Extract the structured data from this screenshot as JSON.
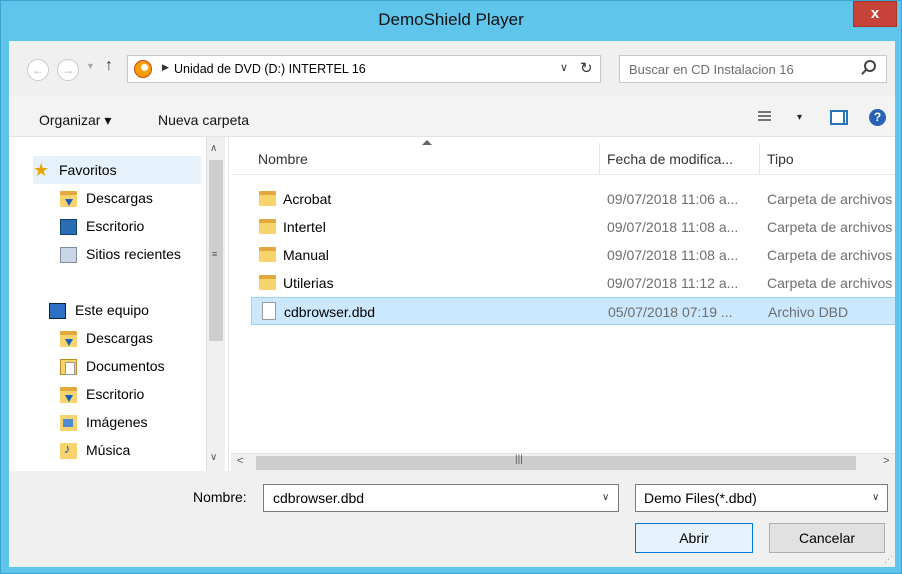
{
  "window": {
    "title": "DemoShield Player",
    "close_label": "x"
  },
  "address": {
    "back": "←",
    "forward": "→",
    "up": "↑",
    "breadcrumb": "Unidad de DVD (D:) INTERTEL 16",
    "dropdown": "∨",
    "refresh": "↻"
  },
  "search": {
    "placeholder": "Buscar en CD Instalacion 16"
  },
  "toolbar": {
    "organize": "Organizar ▾",
    "new_folder": "Nueva carpeta",
    "view_dd": "▾",
    "help": "?"
  },
  "nav": {
    "favorites": {
      "label": "Favoritos",
      "items": [
        "Descargas",
        "Escritorio",
        "Sitios recientes"
      ]
    },
    "this_pc": {
      "label": "Este equipo",
      "items": [
        "Descargas",
        "Documentos",
        "Escritorio",
        "Imágenes",
        "Música"
      ]
    }
  },
  "list": {
    "columns": [
      "Nombre",
      "Fecha de modifica...",
      "Tipo"
    ],
    "rows": [
      {
        "name": "Acrobat",
        "date": "09/07/2018 11:06 a...",
        "type": "Carpeta de archivos",
        "kind": "folder"
      },
      {
        "name": "Intertel",
        "date": "09/07/2018 11:08 a...",
        "type": "Carpeta de archivos",
        "kind": "folder"
      },
      {
        "name": "Manual",
        "date": "09/07/2018 11:08 a...",
        "type": "Carpeta de archivos",
        "kind": "folder"
      },
      {
        "name": "Utilerias",
        "date": "09/07/2018 11:12 a...",
        "type": "Carpeta de archivos",
        "kind": "folder"
      },
      {
        "name": "cdbrowser.dbd",
        "date": "05/07/2018 07:19 ...",
        "type": "Archivo DBD",
        "kind": "file",
        "selected": true
      }
    ]
  },
  "bottom": {
    "name_label": "Nombre:",
    "name_value": "cdbrowser.dbd",
    "filetype": "Demo Files(*.dbd)",
    "open": "Abrir",
    "cancel": "Cancelar"
  },
  "colors": {
    "titlebar": "#5fc5ea",
    "close": "#c7433a",
    "selection": "#cce8ff"
  }
}
